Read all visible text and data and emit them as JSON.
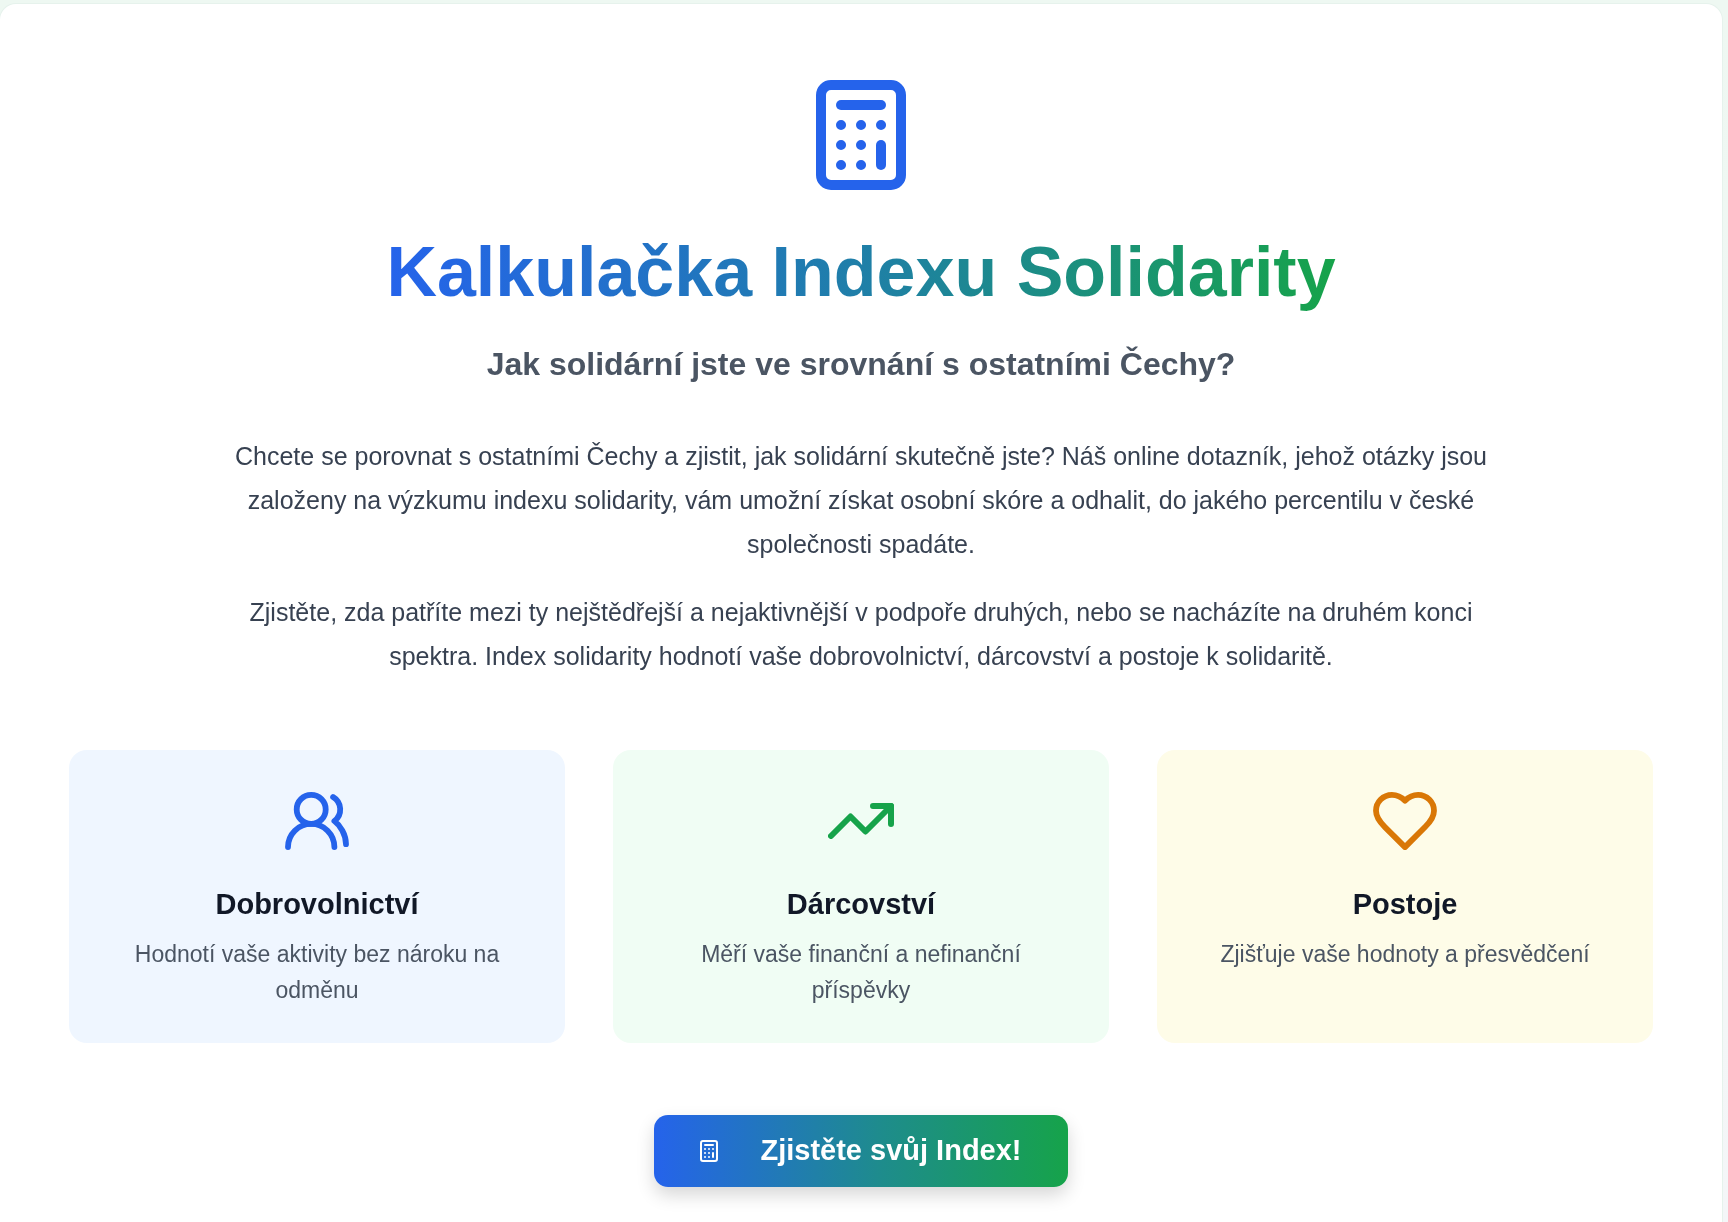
{
  "hero": {
    "title": "Kalkulačka Indexu Solidarity",
    "subtitle": "Jak solidární jste ve srovnání s ostatními Čechy?",
    "paragraphs": [
      "Chcete se porovnat s ostatními Čechy a zjistit, jak solidární skutečně jste? Náš online dotazník, jehož otázky jsou založeny na výzkumu indexu solidarity, vám umožní získat osobní skóre a odhalit, do jakého percentilu v české společnosti spadáte.",
      "Zjistěte, zda patříte mezi ty nejštědřejší a nejaktivnější v podpoře druhých, nebo se nacházíte na druhém konci spektra. Index solidarity hodnotí vaše dobrovolnictví, dárcovství a postoje k solidaritě."
    ]
  },
  "features": [
    {
      "kind": "people",
      "title": "Dobrovolnictví",
      "description": "Hodnotí vaše aktivity bez nároku na odměnu",
      "color": "#2563eb"
    },
    {
      "kind": "growth",
      "title": "Dárcovství",
      "description": "Měří vaše finanční a nefinanční příspěvky",
      "color": "#16a34a"
    },
    {
      "kind": "heart",
      "title": "Postoje",
      "description": "Zjišťuje vaše hodnoty a přesvědčení",
      "color": "#d97706"
    }
  ],
  "cta_button": {
    "label": "Zjistěte svůj Index!"
  }
}
